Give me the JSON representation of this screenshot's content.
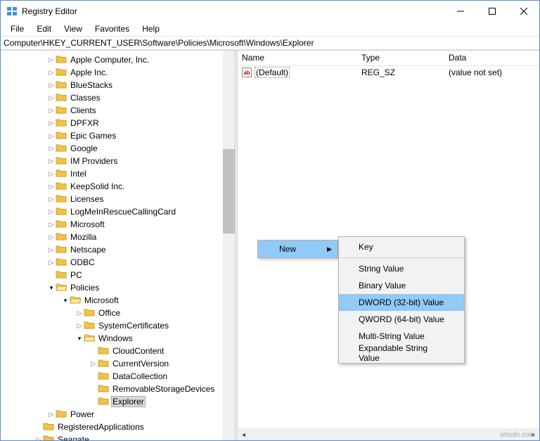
{
  "title": "Registry Editor",
  "menu": [
    "File",
    "Edit",
    "View",
    "Favorites",
    "Help"
  ],
  "address": "Computer\\HKEY_CURRENT_USER\\Software\\Policies\\Microsoft\\Windows\\Explorer",
  "columns": {
    "name": "Name",
    "type": "Type",
    "data": "Data"
  },
  "value_row": {
    "name": "(Default)",
    "type": "REG_SZ",
    "data": "(value not set)"
  },
  "tree": [
    {
      "label": "Apple Computer, Inc.",
      "indent": 66,
      "chev": "closed"
    },
    {
      "label": "Apple Inc.",
      "indent": 66,
      "chev": "closed"
    },
    {
      "label": "BlueStacks",
      "indent": 66,
      "chev": "closed"
    },
    {
      "label": "Classes",
      "indent": 66,
      "chev": "closed"
    },
    {
      "label": "Clients",
      "indent": 66,
      "chev": "closed"
    },
    {
      "label": "DPFXR",
      "indent": 66,
      "chev": "closed"
    },
    {
      "label": "Epic Games",
      "indent": 66,
      "chev": "closed"
    },
    {
      "label": "Google",
      "indent": 66,
      "chev": "closed"
    },
    {
      "label": "IM Providers",
      "indent": 66,
      "chev": "closed"
    },
    {
      "label": "Intel",
      "indent": 66,
      "chev": "closed"
    },
    {
      "label": "KeepSolid Inc.",
      "indent": 66,
      "chev": "closed"
    },
    {
      "label": "Licenses",
      "indent": 66,
      "chev": "closed"
    },
    {
      "label": "LogMeInRescueCallingCard",
      "indent": 66,
      "chev": "closed"
    },
    {
      "label": "Microsoft",
      "indent": 66,
      "chev": "closed"
    },
    {
      "label": "Mozilla",
      "indent": 66,
      "chev": "closed"
    },
    {
      "label": "Netscape",
      "indent": 66,
      "chev": "closed"
    },
    {
      "label": "ODBC",
      "indent": 66,
      "chev": "closed"
    },
    {
      "label": "PC",
      "indent": 66,
      "chev": "none"
    },
    {
      "label": "Policies",
      "indent": 66,
      "chev": "open"
    },
    {
      "label": "Microsoft",
      "indent": 86,
      "chev": "open"
    },
    {
      "label": "Office",
      "indent": 106,
      "chev": "closed"
    },
    {
      "label": "SystemCertificates",
      "indent": 106,
      "chev": "closed"
    },
    {
      "label": "Windows",
      "indent": 106,
      "chev": "open"
    },
    {
      "label": "CloudContent",
      "indent": 126,
      "chev": "none"
    },
    {
      "label": "CurrentVersion",
      "indent": 126,
      "chev": "closed"
    },
    {
      "label": "DataCollection",
      "indent": 126,
      "chev": "none"
    },
    {
      "label": "RemovableStorageDevices",
      "indent": 126,
      "chev": "none"
    },
    {
      "label": "Explorer",
      "indent": 126,
      "chev": "none",
      "selected": true
    },
    {
      "label": "Power",
      "indent": 66,
      "chev": "closed"
    },
    {
      "label": "RegisteredApplications",
      "indent": 48,
      "chev": "none"
    },
    {
      "label": "Seagate",
      "indent": 48,
      "chev": "closed"
    }
  ],
  "context": {
    "new": "New",
    "items": [
      {
        "label": "Key",
        "hl": false,
        "sep_after": true
      },
      {
        "label": "String Value",
        "hl": false
      },
      {
        "label": "Binary Value",
        "hl": false
      },
      {
        "label": "DWORD (32-bit) Value",
        "hl": true
      },
      {
        "label": "QWORD (64-bit) Value",
        "hl": false
      },
      {
        "label": "Multi-String Value",
        "hl": false
      },
      {
        "label": "Expandable String Value",
        "hl": false
      }
    ]
  },
  "watermark": "wsxdn.com"
}
